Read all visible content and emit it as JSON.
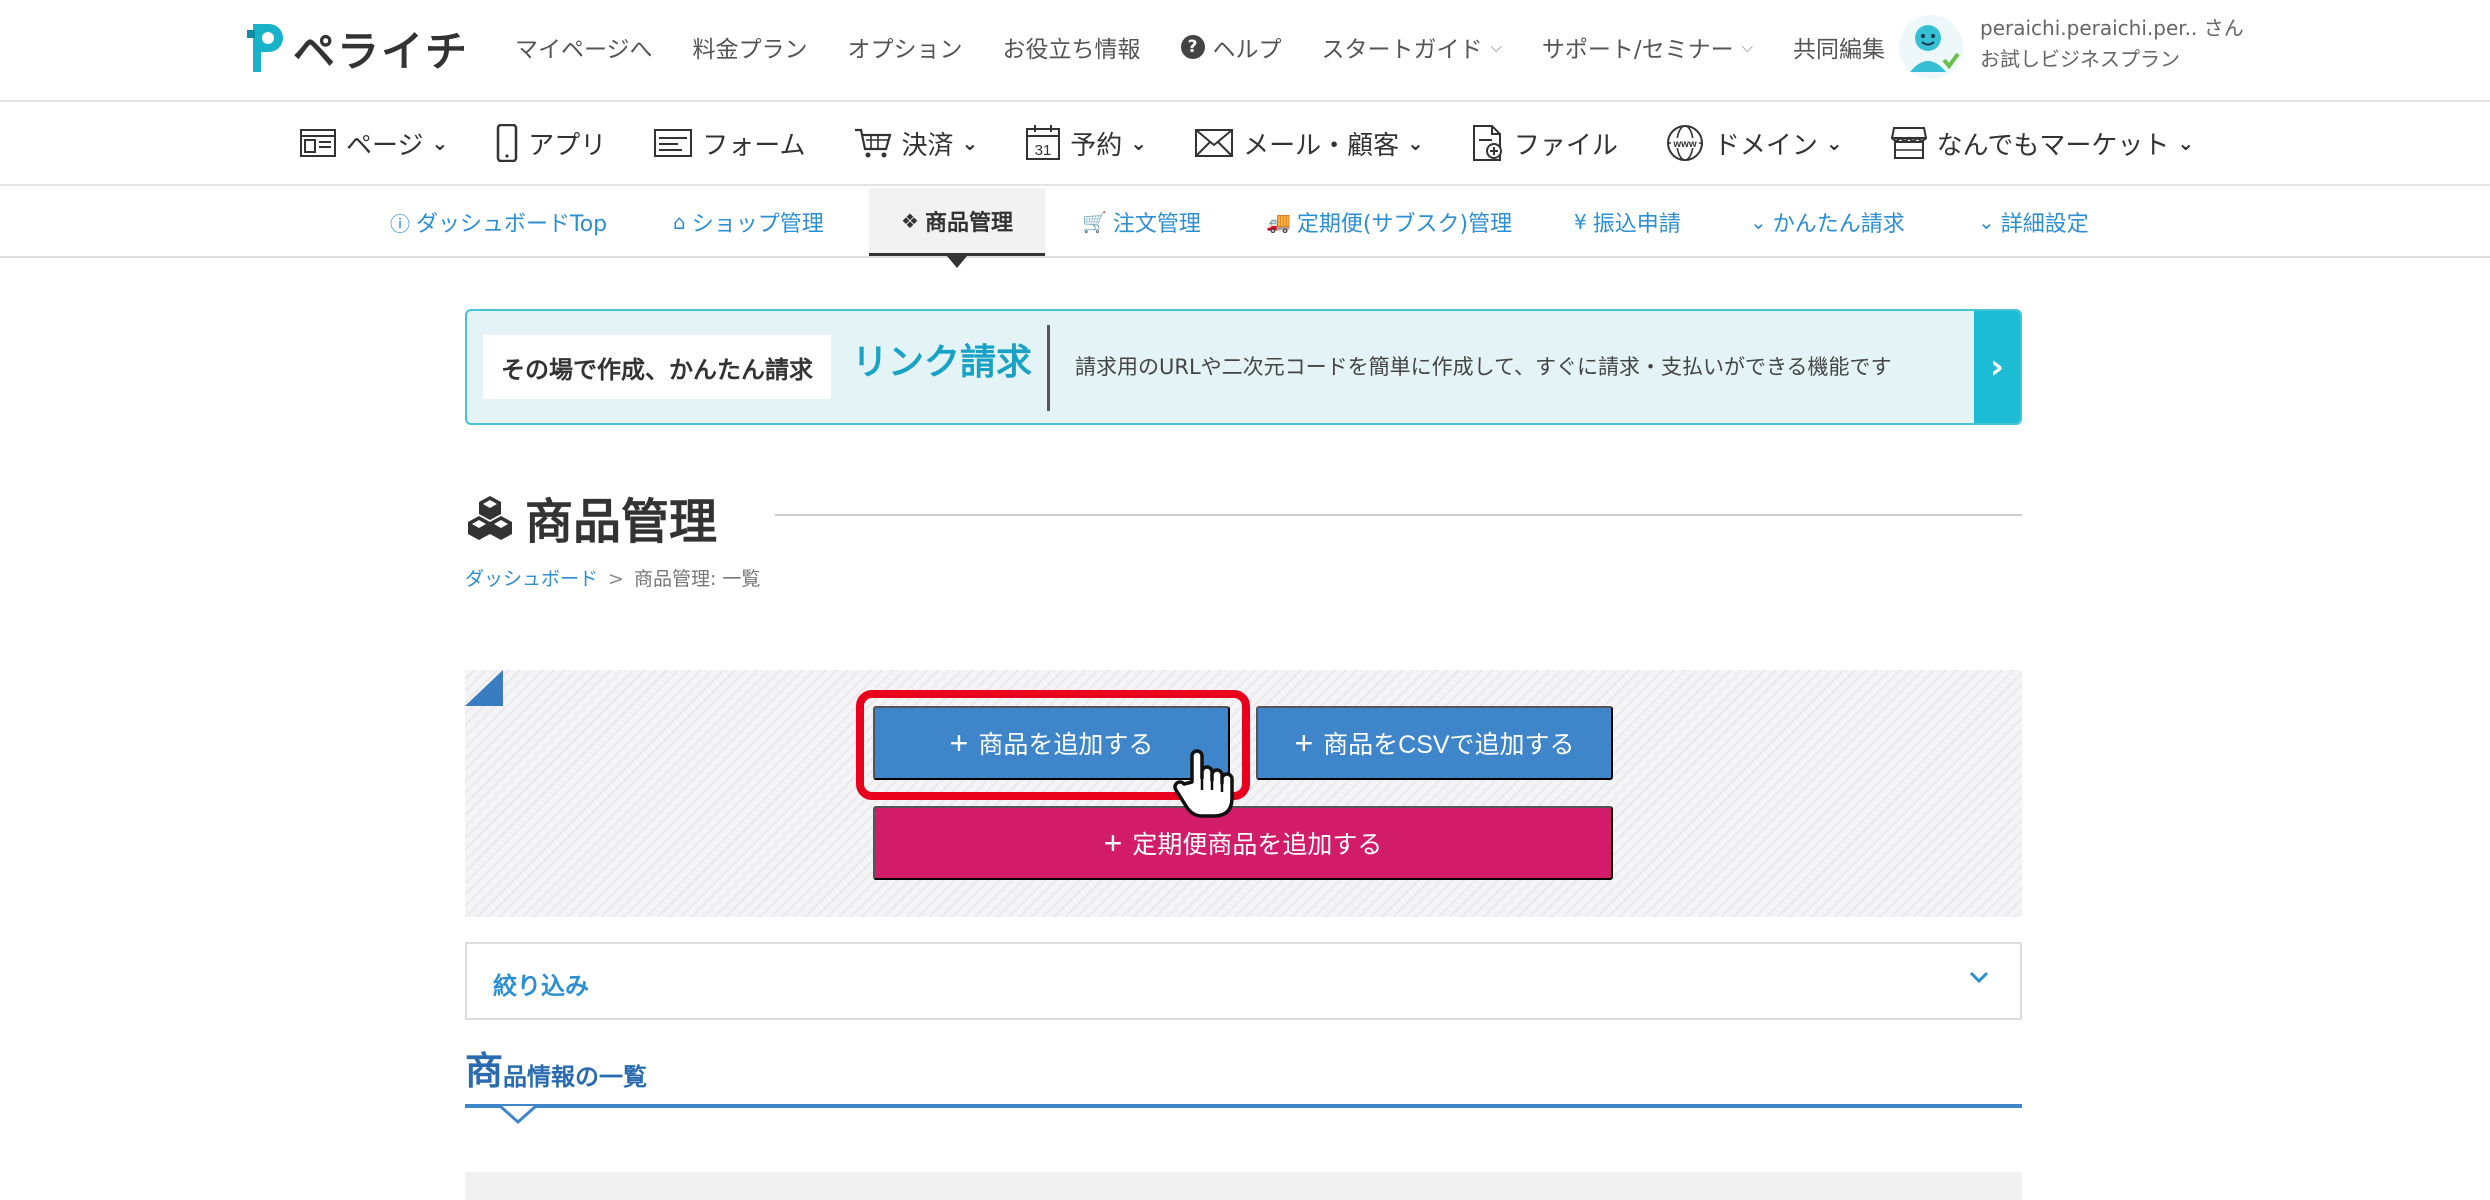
{
  "header": {
    "logo_text": "ペライチ",
    "nav": [
      {
        "label": "マイページへ",
        "dropdown": false
      },
      {
        "label": "料金プラン",
        "dropdown": false
      },
      {
        "label": "オプション",
        "dropdown": false
      },
      {
        "label": "お役立ち情報",
        "dropdown": false
      },
      {
        "label": "ヘルプ",
        "dropdown": false,
        "icon": "question-circle-icon"
      },
      {
        "label": "スタートガイド",
        "dropdown": true
      },
      {
        "label": "サポート/セミナー",
        "dropdown": true
      },
      {
        "label": "共同編集",
        "dropdown": false
      }
    ],
    "user": {
      "name": "peraichi.peraichi.per.. さん",
      "plan": "お試しビジネスプラン"
    }
  },
  "service_menu": [
    {
      "label": "ページ",
      "icon": "page-icon",
      "dropdown": true
    },
    {
      "label": "アプリ",
      "icon": "smartphone-icon",
      "dropdown": false
    },
    {
      "label": "フォーム",
      "icon": "form-icon",
      "dropdown": false
    },
    {
      "label": "決済",
      "icon": "cart-icon",
      "dropdown": true
    },
    {
      "label": "予約",
      "icon": "calendar-icon",
      "dropdown": true
    },
    {
      "label": "メール・顧客",
      "icon": "mail-icon",
      "dropdown": true
    },
    {
      "label": "ファイル",
      "icon": "file-icon",
      "dropdown": false
    },
    {
      "label": "ドメイン",
      "icon": "www-icon",
      "dropdown": true
    },
    {
      "label": "なんでもマーケット",
      "icon": "store-icon",
      "dropdown": true
    }
  ],
  "sub_nav": [
    {
      "label": "ダッシュボードTop",
      "icon": "info-icon",
      "active": false
    },
    {
      "label": "ショップ管理",
      "icon": "home-icon",
      "active": false
    },
    {
      "label": "商品管理",
      "icon": "cubes-icon",
      "active": true
    },
    {
      "label": "注文管理",
      "icon": "cart-icon",
      "active": false
    },
    {
      "label": "定期便(サブスク)管理",
      "icon": "truck-icon",
      "active": false
    },
    {
      "label": "振込申請",
      "icon": "yen-icon",
      "active": false
    },
    {
      "label": "かんたん請求",
      "icon": "chevron-down-icon",
      "active": false
    },
    {
      "label": "詳細設定",
      "icon": "chevron-down-icon",
      "active": false
    }
  ],
  "banner": {
    "tag": "その場で作成、かんたん請求",
    "title": "リンク請求",
    "description": "請求用のURLや二次元コードを簡単に作成して、すぐに請求・支払いができる機能です",
    "arrow": "›"
  },
  "page": {
    "title": "商品管理",
    "breadcrumb": {
      "link": "ダッシュボード",
      "separator": ">",
      "current": "商品管理: 一覧"
    }
  },
  "actions": {
    "add_product": "商品を追加する",
    "add_csv": "商品をCSVで追加する",
    "add_subscription": "定期便商品を追加する",
    "plus": "+"
  },
  "filter": {
    "label": "絞り込み"
  },
  "list": {
    "heading_first": "商",
    "heading_rest": "品情報の一覧"
  },
  "colors": {
    "primary_blue": "#3f85c9",
    "link_blue": "#2b8fd3",
    "pink": "#d21c6a",
    "highlight_red": "#e8001c",
    "banner_teal": "#1cbcd4"
  }
}
